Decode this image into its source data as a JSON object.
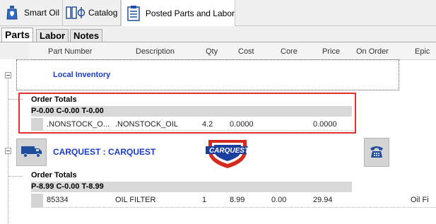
{
  "top_tabs": [
    {
      "label": "Smart Oil",
      "icon": "oil-bottle-icon"
    },
    {
      "label": "Catalog",
      "icon": "catalog-icon"
    },
    {
      "label": "Posted Parts and Labor",
      "icon": "posted-parts-icon",
      "active": true
    }
  ],
  "inner_tabs": [
    {
      "label": "Parts",
      "active": true
    },
    {
      "label": "Labor"
    },
    {
      "label": "Notes"
    }
  ],
  "columns": [
    "Part Number",
    "Description",
    "Qty",
    "Cost",
    "Core",
    "Price",
    "On Order",
    "Epic"
  ],
  "local_inventory": {
    "name": "Local Inventory",
    "totals_title": "Order Totals",
    "totals": "P-0.00 C-0.00 T-0.00",
    "row": {
      "part_number": ".NONSTOCK_O...",
      "description": ".NONSTOCK_OIL",
      "qty": "4.2",
      "cost": "0.0000",
      "core": "",
      "price": "0.0000"
    }
  },
  "carquest": {
    "name": "CARQUEST : CARQUEST",
    "logo_text": "CARQUEST",
    "totals_title": "Order Totals",
    "totals": "P-8.99 C-0.00 T-8.99",
    "row": {
      "part_number": "85334",
      "description": "OIL FILTER",
      "qty": "1",
      "cost": "8.99",
      "core": "0.00",
      "price": "29.94",
      "epic": "Oil Fi"
    }
  },
  "colors": {
    "vendor_name": "#1a3cc8",
    "highlight": "#e03030",
    "logo_blue": "#1b3f9e",
    "logo_red": "#d52b1e"
  }
}
